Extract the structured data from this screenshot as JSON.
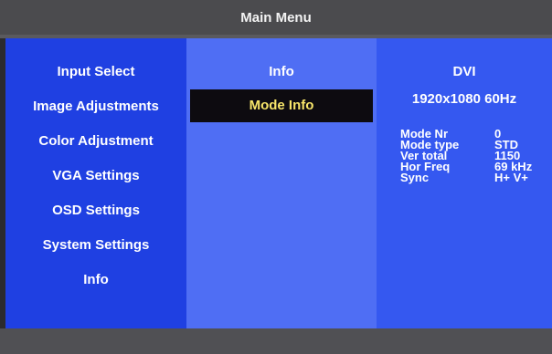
{
  "header": {
    "title": "Main Menu"
  },
  "main_menu": {
    "items": [
      {
        "label": "Input Select"
      },
      {
        "label": "Image Adjustments"
      },
      {
        "label": "Color Adjustment"
      },
      {
        "label": "VGA Settings"
      },
      {
        "label": "OSD Settings"
      },
      {
        "label": "System Settings"
      },
      {
        "label": "Info"
      }
    ]
  },
  "submenu": {
    "header": "Info",
    "items": [
      {
        "label": "Mode Info",
        "selected": true
      }
    ]
  },
  "info_panel": {
    "input": "DVI",
    "resolution": "1920x1080 60Hz",
    "rows": [
      {
        "key": "Mode Nr",
        "value": "0"
      },
      {
        "key": "Mode type",
        "value": "STD"
      },
      {
        "key": "Ver total",
        "value": "1150"
      },
      {
        "key": "Hor Freq",
        "value": "69 kHz"
      },
      {
        "key": "Sync",
        "value": "H+ V+"
      }
    ]
  },
  "colors": {
    "title_bar": "#4b4b4e",
    "menu_column": "#1f40e2",
    "submenu_column": "#4f6ef4",
    "info_column": "#3558f0",
    "selection_background": "#0d0b10",
    "selection_text": "#f7e56a"
  }
}
